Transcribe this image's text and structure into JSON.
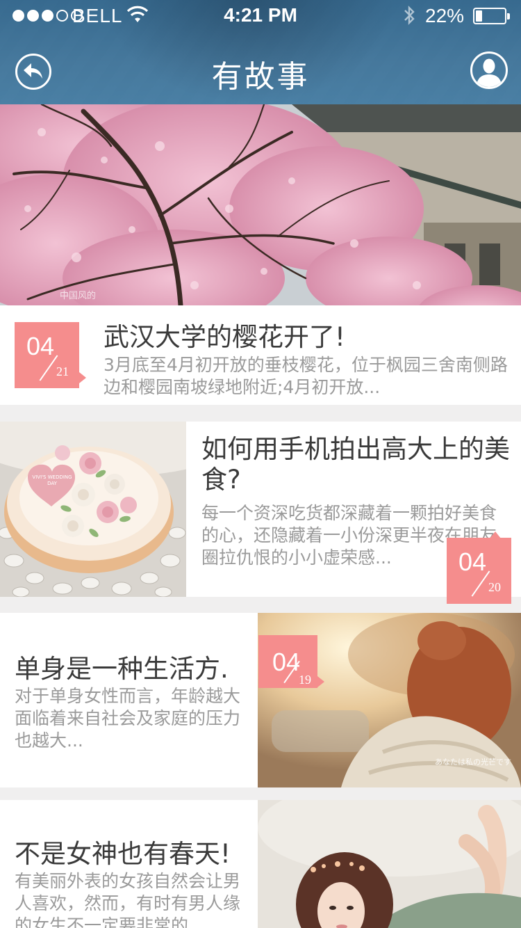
{
  "status_bar": {
    "carrier": "BELL",
    "time": "4:21 PM",
    "battery_percent": "22%",
    "battery_level": 0.22,
    "signal_bars_filled": 3,
    "signal_bars_total": 5
  },
  "nav": {
    "title": "有故事",
    "back_icon": "back-arrow-icon",
    "user_icon": "user-profile-icon"
  },
  "hero": {
    "watermark": "中国风的"
  },
  "stories": [
    {
      "title": "武汉大学的樱花开了!",
      "excerpt": "3月底至4月初开放的垂枝樱花，位于枫园三舍南侧路边和樱园南坡绿地附近;4月初开放...",
      "month": "04",
      "day": "21"
    },
    {
      "title": "如何用手机拍出高大上的美食?",
      "excerpt": "每一个资深吃货都深藏着一颗拍好美食的心，还隐藏着一小份深更半夜在朋友圈拉仇恨的小小虚荣感...",
      "month": "04",
      "day": "20",
      "image_text": "VIVI'S WEDDING DAY"
    },
    {
      "title": "单身是一种生活方.",
      "excerpt": "对于单身女性而言，年龄越大面临着来自社会及家庭的压力也越大...",
      "month": "04",
      "day": "19",
      "image_caption": "あなたは私の光芒です"
    },
    {
      "title": "不是女神也有春天!",
      "excerpt": "有美丽外表的女孩自然会让男人喜欢，然而，有时有男人缘的女生不一定要非常的"
    }
  ],
  "colors": {
    "nav_bg": "#2f6890",
    "badge": "#f58d8d",
    "title_text": "#3a3a3a",
    "excerpt_text": "#9a9a9a",
    "separator": "#f0efef"
  }
}
